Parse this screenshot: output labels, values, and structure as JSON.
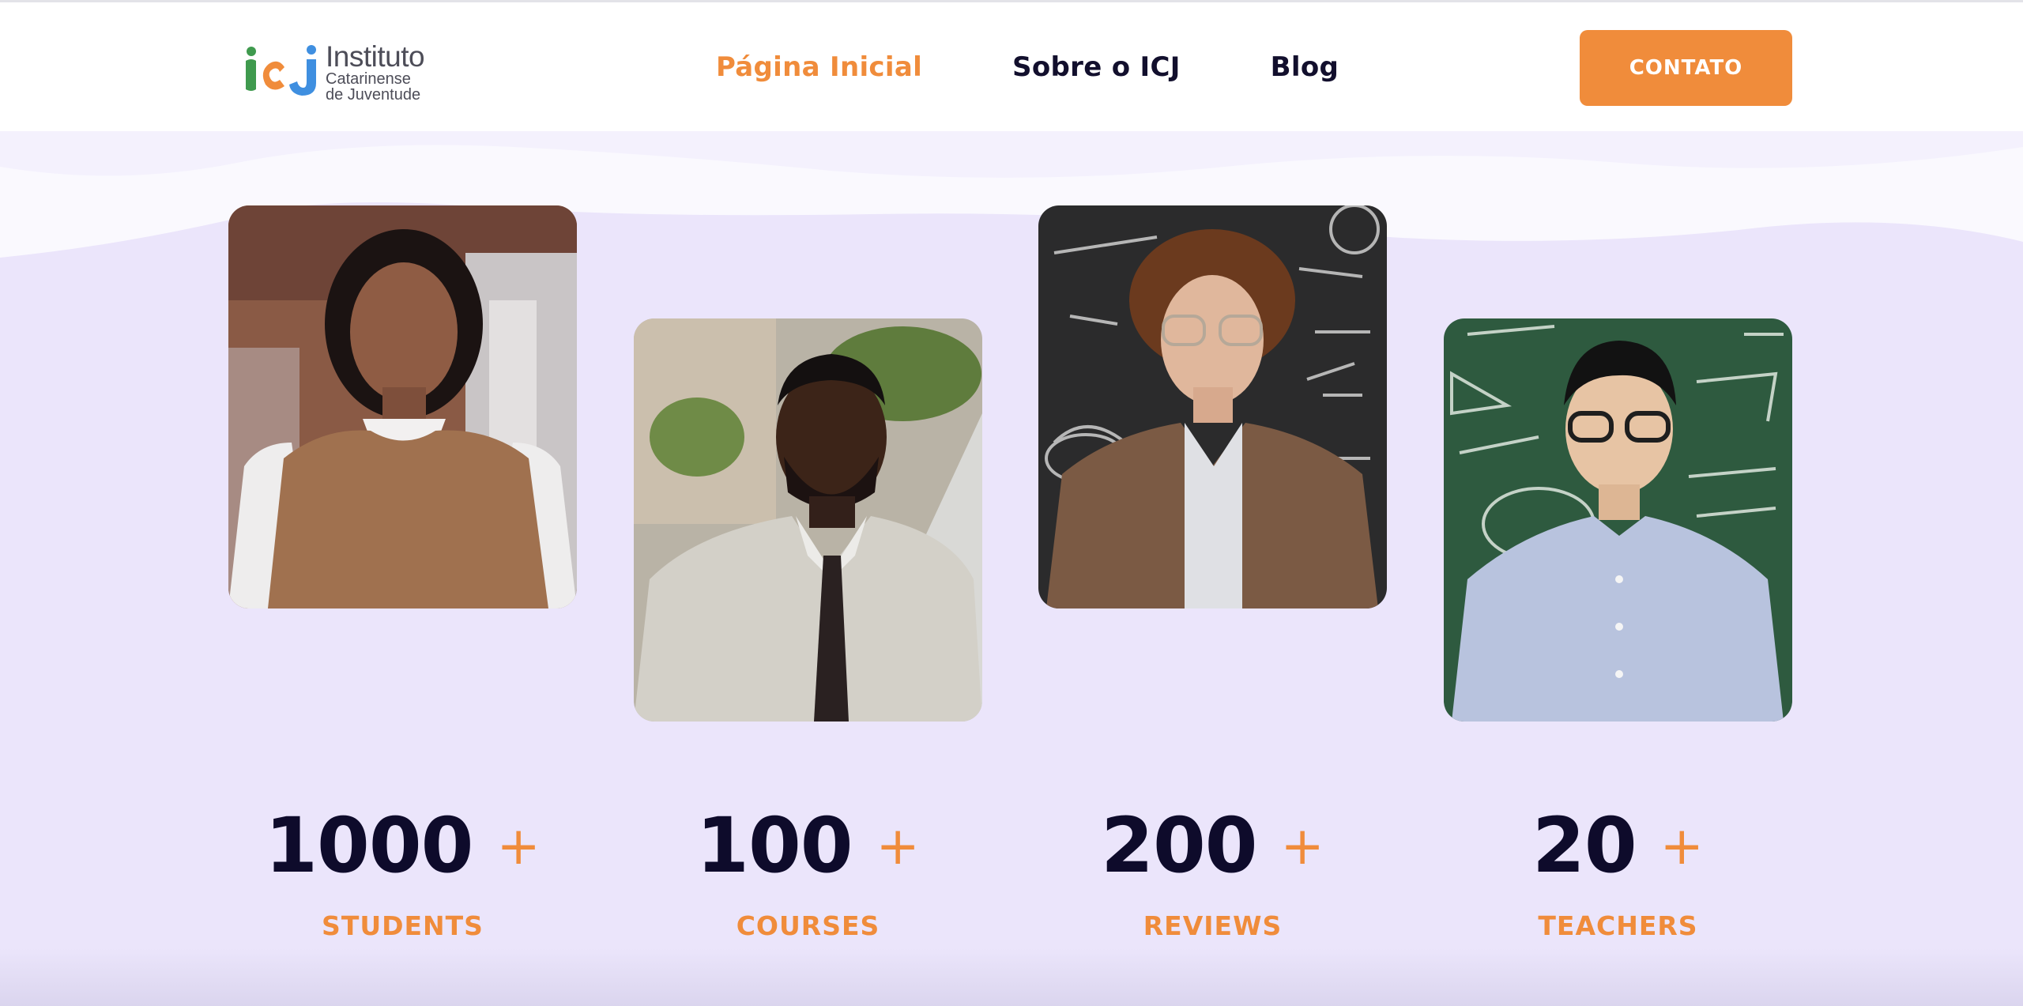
{
  "header": {
    "logo": {
      "mark_text": "icj",
      "line1": "Instituto",
      "line2": "Catarinense",
      "line3": "de Juventude"
    },
    "nav": [
      {
        "label": "Página Inicial",
        "active": true
      },
      {
        "label": "Sobre o ICJ",
        "active": false
      },
      {
        "label": "Blog",
        "active": false
      }
    ],
    "contact_button": "CONTATO"
  },
  "colors": {
    "accent": "#f08c3b",
    "text_dark": "#0e0b2b",
    "background": "#ebe5fb",
    "header_bg": "#ffffff"
  },
  "cards": [
    {
      "image": "woman-teacher-portrait",
      "icon": "person-photo"
    },
    {
      "image": "man-teacher-portrait",
      "icon": "person-photo"
    },
    {
      "image": "woman-chalkboard-portrait",
      "icon": "person-photo"
    },
    {
      "image": "man-chalkboard-portrait",
      "icon": "person-photo"
    }
  ],
  "stats": [
    {
      "number": "1000",
      "plus": "+",
      "label": "STUDENTS"
    },
    {
      "number": "100",
      "plus": "+",
      "label": "COURSES"
    },
    {
      "number": "200",
      "plus": "+",
      "label": "REVIEWS"
    },
    {
      "number": "20",
      "plus": "+",
      "label": "TEACHERS"
    }
  ]
}
